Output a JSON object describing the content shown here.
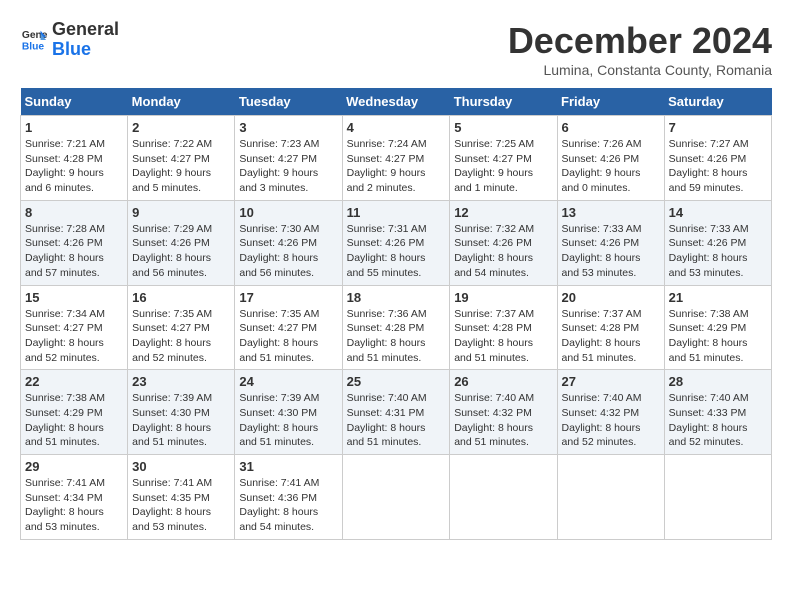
{
  "logo": {
    "line1": "General",
    "line2": "Blue"
  },
  "title": "December 2024",
  "subtitle": "Lumina, Constanta County, Romania",
  "header_row": [
    "Sunday",
    "Monday",
    "Tuesday",
    "Wednesday",
    "Thursday",
    "Friday",
    "Saturday"
  ],
  "weeks": [
    [
      {
        "day": "1",
        "sunrise": "7:21 AM",
        "sunset": "4:28 PM",
        "daylight": "9 hours and 6 minutes."
      },
      {
        "day": "2",
        "sunrise": "7:22 AM",
        "sunset": "4:27 PM",
        "daylight": "9 hours and 5 minutes."
      },
      {
        "day": "3",
        "sunrise": "7:23 AM",
        "sunset": "4:27 PM",
        "daylight": "9 hours and 3 minutes."
      },
      {
        "day": "4",
        "sunrise": "7:24 AM",
        "sunset": "4:27 PM",
        "daylight": "9 hours and 2 minutes."
      },
      {
        "day": "5",
        "sunrise": "7:25 AM",
        "sunset": "4:27 PM",
        "daylight": "9 hours and 1 minute."
      },
      {
        "day": "6",
        "sunrise": "7:26 AM",
        "sunset": "4:26 PM",
        "daylight": "9 hours and 0 minutes."
      },
      {
        "day": "7",
        "sunrise": "7:27 AM",
        "sunset": "4:26 PM",
        "daylight": "8 hours and 59 minutes."
      }
    ],
    [
      {
        "day": "8",
        "sunrise": "7:28 AM",
        "sunset": "4:26 PM",
        "daylight": "8 hours and 57 minutes."
      },
      {
        "day": "9",
        "sunrise": "7:29 AM",
        "sunset": "4:26 PM",
        "daylight": "8 hours and 56 minutes."
      },
      {
        "day": "10",
        "sunrise": "7:30 AM",
        "sunset": "4:26 PM",
        "daylight": "8 hours and 56 minutes."
      },
      {
        "day": "11",
        "sunrise": "7:31 AM",
        "sunset": "4:26 PM",
        "daylight": "8 hours and 55 minutes."
      },
      {
        "day": "12",
        "sunrise": "7:32 AM",
        "sunset": "4:26 PM",
        "daylight": "8 hours and 54 minutes."
      },
      {
        "day": "13",
        "sunrise": "7:33 AM",
        "sunset": "4:26 PM",
        "daylight": "8 hours and 53 minutes."
      },
      {
        "day": "14",
        "sunrise": "7:33 AM",
        "sunset": "4:26 PM",
        "daylight": "8 hours and 53 minutes."
      }
    ],
    [
      {
        "day": "15",
        "sunrise": "7:34 AM",
        "sunset": "4:27 PM",
        "daylight": "8 hours and 52 minutes."
      },
      {
        "day": "16",
        "sunrise": "7:35 AM",
        "sunset": "4:27 PM",
        "daylight": "8 hours and 52 minutes."
      },
      {
        "day": "17",
        "sunrise": "7:35 AM",
        "sunset": "4:27 PM",
        "daylight": "8 hours and 51 minutes."
      },
      {
        "day": "18",
        "sunrise": "7:36 AM",
        "sunset": "4:28 PM",
        "daylight": "8 hours and 51 minutes."
      },
      {
        "day": "19",
        "sunrise": "7:37 AM",
        "sunset": "4:28 PM",
        "daylight": "8 hours and 51 minutes."
      },
      {
        "day": "20",
        "sunrise": "7:37 AM",
        "sunset": "4:28 PM",
        "daylight": "8 hours and 51 minutes."
      },
      {
        "day": "21",
        "sunrise": "7:38 AM",
        "sunset": "4:29 PM",
        "daylight": "8 hours and 51 minutes."
      }
    ],
    [
      {
        "day": "22",
        "sunrise": "7:38 AM",
        "sunset": "4:29 PM",
        "daylight": "8 hours and 51 minutes."
      },
      {
        "day": "23",
        "sunrise": "7:39 AM",
        "sunset": "4:30 PM",
        "daylight": "8 hours and 51 minutes."
      },
      {
        "day": "24",
        "sunrise": "7:39 AM",
        "sunset": "4:30 PM",
        "daylight": "8 hours and 51 minutes."
      },
      {
        "day": "25",
        "sunrise": "7:40 AM",
        "sunset": "4:31 PM",
        "daylight": "8 hours and 51 minutes."
      },
      {
        "day": "26",
        "sunrise": "7:40 AM",
        "sunset": "4:32 PM",
        "daylight": "8 hours and 51 minutes."
      },
      {
        "day": "27",
        "sunrise": "7:40 AM",
        "sunset": "4:32 PM",
        "daylight": "8 hours and 52 minutes."
      },
      {
        "day": "28",
        "sunrise": "7:40 AM",
        "sunset": "4:33 PM",
        "daylight": "8 hours and 52 minutes."
      }
    ],
    [
      {
        "day": "29",
        "sunrise": "7:41 AM",
        "sunset": "4:34 PM",
        "daylight": "8 hours and 53 minutes."
      },
      {
        "day": "30",
        "sunrise": "7:41 AM",
        "sunset": "4:35 PM",
        "daylight": "8 hours and 53 minutes."
      },
      {
        "day": "31",
        "sunrise": "7:41 AM",
        "sunset": "4:36 PM",
        "daylight": "8 hours and 54 minutes."
      },
      null,
      null,
      null,
      null
    ]
  ]
}
